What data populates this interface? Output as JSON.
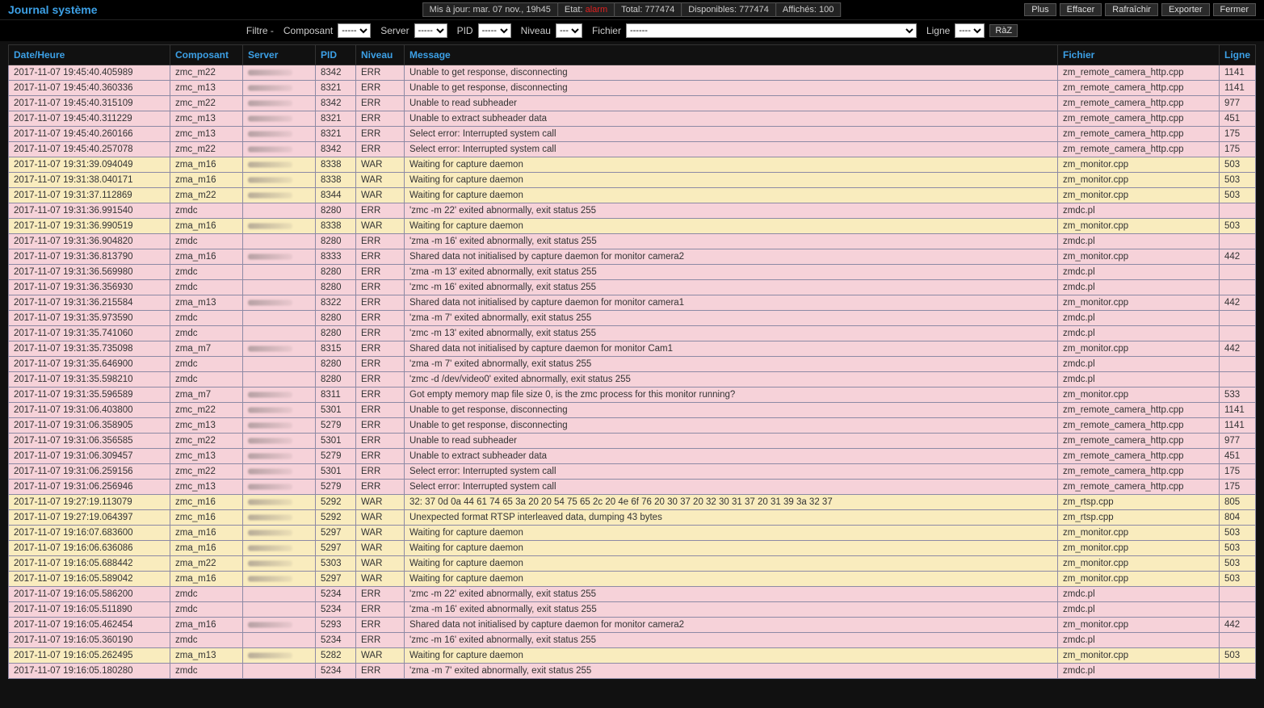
{
  "page": {
    "title": "Journal système"
  },
  "status": {
    "updated_label": "Mis à jour:",
    "updated_value": "mar. 07 nov., 19h45",
    "state_label": "Etat:",
    "state_value": "alarm",
    "total_label": "Total:",
    "total_value": "777474",
    "avail_label": "Disponibles:",
    "avail_value": "777474",
    "shown_label": "Affichés:",
    "shown_value": "100"
  },
  "buttons": {
    "plus": "Plus",
    "effacer": "Effacer",
    "rafraichir": "Rafraîchir",
    "exporter": "Exporter",
    "fermer": "Fermer"
  },
  "filters": {
    "prefix": "Filtre -",
    "composant": "Composant",
    "server": "Server",
    "pid": "PID",
    "niveau": "Niveau",
    "fichier": "Fichier",
    "ligne": "Ligne",
    "raz": "RàZ",
    "dashes5": "-----",
    "dashes3": "---",
    "dashes6": "------",
    "dashes4": "----"
  },
  "columns": {
    "date": "Date/Heure",
    "composant": "Composant",
    "server": "Server",
    "pid": "PID",
    "niveau": "Niveau",
    "message": "Message",
    "fichier": "Fichier",
    "ligne": "Ligne"
  },
  "rows": [
    {
      "date": "2017-11-07 19:45:40.405989",
      "comp": "zmc_m22",
      "server": "x",
      "pid": "8342",
      "lvl": "ERR",
      "msg": "Unable to get response, disconnecting",
      "file": "zm_remote_camera_http.cpp",
      "line": "1141"
    },
    {
      "date": "2017-11-07 19:45:40.360336",
      "comp": "zmc_m13",
      "server": "x",
      "pid": "8321",
      "lvl": "ERR",
      "msg": "Unable to get response, disconnecting",
      "file": "zm_remote_camera_http.cpp",
      "line": "1141"
    },
    {
      "date": "2017-11-07 19:45:40.315109",
      "comp": "zmc_m22",
      "server": "x",
      "pid": "8342",
      "lvl": "ERR",
      "msg": "Unable to read subheader",
      "file": "zm_remote_camera_http.cpp",
      "line": "977"
    },
    {
      "date": "2017-11-07 19:45:40.311229",
      "comp": "zmc_m13",
      "server": "x",
      "pid": "8321",
      "lvl": "ERR",
      "msg": "Unable to extract subheader data",
      "file": "zm_remote_camera_http.cpp",
      "line": "451"
    },
    {
      "date": "2017-11-07 19:45:40.260166",
      "comp": "zmc_m13",
      "server": "x",
      "pid": "8321",
      "lvl": "ERR",
      "msg": "Select error: Interrupted system call",
      "file": "zm_remote_camera_http.cpp",
      "line": "175"
    },
    {
      "date": "2017-11-07 19:45:40.257078",
      "comp": "zmc_m22",
      "server": "x",
      "pid": "8342",
      "lvl": "ERR",
      "msg": "Select error: Interrupted system call",
      "file": "zm_remote_camera_http.cpp",
      "line": "175"
    },
    {
      "date": "2017-11-07 19:31:39.094049",
      "comp": "zma_m16",
      "server": "x",
      "pid": "8338",
      "lvl": "WAR",
      "msg": "Waiting for capture daemon",
      "file": "zm_monitor.cpp",
      "line": "503"
    },
    {
      "date": "2017-11-07 19:31:38.040171",
      "comp": "zma_m16",
      "server": "x",
      "pid": "8338",
      "lvl": "WAR",
      "msg": "Waiting for capture daemon",
      "file": "zm_monitor.cpp",
      "line": "503"
    },
    {
      "date": "2017-11-07 19:31:37.112869",
      "comp": "zma_m22",
      "server": "x",
      "pid": "8344",
      "lvl": "WAR",
      "msg": "Waiting for capture daemon",
      "file": "zm_monitor.cpp",
      "line": "503"
    },
    {
      "date": "2017-11-07 19:31:36.991540",
      "comp": "zmdc",
      "server": "",
      "pid": "8280",
      "lvl": "ERR",
      "msg": "'zmc -m 22' exited abnormally, exit status 255",
      "file": "zmdc.pl",
      "line": ""
    },
    {
      "date": "2017-11-07 19:31:36.990519",
      "comp": "zma_m16",
      "server": "x",
      "pid": "8338",
      "lvl": "WAR",
      "msg": "Waiting for capture daemon",
      "file": "zm_monitor.cpp",
      "line": "503"
    },
    {
      "date": "2017-11-07 19:31:36.904820",
      "comp": "zmdc",
      "server": "",
      "pid": "8280",
      "lvl": "ERR",
      "msg": "'zma -m 16' exited abnormally, exit status 255",
      "file": "zmdc.pl",
      "line": ""
    },
    {
      "date": "2017-11-07 19:31:36.813790",
      "comp": "zma_m16",
      "server": "x",
      "pid": "8333",
      "lvl": "ERR",
      "msg": "Shared data not initialised by capture daemon for monitor camera2",
      "file": "zm_monitor.cpp",
      "line": "442"
    },
    {
      "date": "2017-11-07 19:31:36.569980",
      "comp": "zmdc",
      "server": "",
      "pid": "8280",
      "lvl": "ERR",
      "msg": "'zma -m 13' exited abnormally, exit status 255",
      "file": "zmdc.pl",
      "line": ""
    },
    {
      "date": "2017-11-07 19:31:36.356930",
      "comp": "zmdc",
      "server": "",
      "pid": "8280",
      "lvl": "ERR",
      "msg": "'zmc -m 16' exited abnormally, exit status 255",
      "file": "zmdc.pl",
      "line": ""
    },
    {
      "date": "2017-11-07 19:31:36.215584",
      "comp": "zma_m13",
      "server": "x",
      "pid": "8322",
      "lvl": "ERR",
      "msg": "Shared data not initialised by capture daemon for monitor camera1",
      "file": "zm_monitor.cpp",
      "line": "442"
    },
    {
      "date": "2017-11-07 19:31:35.973590",
      "comp": "zmdc",
      "server": "",
      "pid": "8280",
      "lvl": "ERR",
      "msg": "'zma -m 7' exited abnormally, exit status 255",
      "file": "zmdc.pl",
      "line": ""
    },
    {
      "date": "2017-11-07 19:31:35.741060",
      "comp": "zmdc",
      "server": "",
      "pid": "8280",
      "lvl": "ERR",
      "msg": "'zmc -m 13' exited abnormally, exit status 255",
      "file": "zmdc.pl",
      "line": ""
    },
    {
      "date": "2017-11-07 19:31:35.735098",
      "comp": "zma_m7",
      "server": "x",
      "pid": "8315",
      "lvl": "ERR",
      "msg": "Shared data not initialised by capture daemon for monitor            Cam1",
      "file": "zm_monitor.cpp",
      "line": "442"
    },
    {
      "date": "2017-11-07 19:31:35.646900",
      "comp": "zmdc",
      "server": "",
      "pid": "8280",
      "lvl": "ERR",
      "msg": "'zma -m 7' exited abnormally, exit status 255",
      "file": "zmdc.pl",
      "line": ""
    },
    {
      "date": "2017-11-07 19:31:35.598210",
      "comp": "zmdc",
      "server": "",
      "pid": "8280",
      "lvl": "ERR",
      "msg": "'zmc -d /dev/video0' exited abnormally, exit status 255",
      "file": "zmdc.pl",
      "line": ""
    },
    {
      "date": "2017-11-07 19:31:35.596589",
      "comp": "zma_m7",
      "server": "x",
      "pid": "8311",
      "lvl": "ERR",
      "msg": "Got empty memory map file size 0, is the zmc process for this monitor running?",
      "file": "zm_monitor.cpp",
      "line": "533"
    },
    {
      "date": "2017-11-07 19:31:06.403800",
      "comp": "zmc_m22",
      "server": "x",
      "pid": "5301",
      "lvl": "ERR",
      "msg": "Unable to get response, disconnecting",
      "file": "zm_remote_camera_http.cpp",
      "line": "1141"
    },
    {
      "date": "2017-11-07 19:31:06.358905",
      "comp": "zmc_m13",
      "server": "x",
      "pid": "5279",
      "lvl": "ERR",
      "msg": "Unable to get response, disconnecting",
      "file": "zm_remote_camera_http.cpp",
      "line": "1141"
    },
    {
      "date": "2017-11-07 19:31:06.356585",
      "comp": "zmc_m22",
      "server": "x",
      "pid": "5301",
      "lvl": "ERR",
      "msg": "Unable to read subheader",
      "file": "zm_remote_camera_http.cpp",
      "line": "977"
    },
    {
      "date": "2017-11-07 19:31:06.309457",
      "comp": "zmc_m13",
      "server": "x",
      "pid": "5279",
      "lvl": "ERR",
      "msg": "Unable to extract subheader data",
      "file": "zm_remote_camera_http.cpp",
      "line": "451"
    },
    {
      "date": "2017-11-07 19:31:06.259156",
      "comp": "zmc_m22",
      "server": "x",
      "pid": "5301",
      "lvl": "ERR",
      "msg": "Select error: Interrupted system call",
      "file": "zm_remote_camera_http.cpp",
      "line": "175"
    },
    {
      "date": "2017-11-07 19:31:06.256946",
      "comp": "zmc_m13",
      "server": "x",
      "pid": "5279",
      "lvl": "ERR",
      "msg": "Select error: Interrupted system call",
      "file": "zm_remote_camera_http.cpp",
      "line": "175"
    },
    {
      "date": "2017-11-07 19:27:19.113079",
      "comp": "zmc_m16",
      "server": "x",
      "pid": "5292",
      "lvl": "WAR",
      "msg": "32: 37 0d 0a 44 61 74 65 3a 20 20 54 75 65 2c 20 4e 6f 76 20 30 37 20 32 30 31 37 20 31 39 3a 32 37",
      "file": "zm_rtsp.cpp",
      "line": "805"
    },
    {
      "date": "2017-11-07 19:27:19.064397",
      "comp": "zmc_m16",
      "server": "x",
      "pid": "5292",
      "lvl": "WAR",
      "msg": "Unexpected format RTSP interleaved data, dumping 43 bytes",
      "file": "zm_rtsp.cpp",
      "line": "804"
    },
    {
      "date": "2017-11-07 19:16:07.683600",
      "comp": "zma_m16",
      "server": "x",
      "pid": "5297",
      "lvl": "WAR",
      "msg": "Waiting for capture daemon",
      "file": "zm_monitor.cpp",
      "line": "503"
    },
    {
      "date": "2017-11-07 19:16:06.636086",
      "comp": "zma_m16",
      "server": "x",
      "pid": "5297",
      "lvl": "WAR",
      "msg": "Waiting for capture daemon",
      "file": "zm_monitor.cpp",
      "line": "503"
    },
    {
      "date": "2017-11-07 19:16:05.688442",
      "comp": "zma_m22",
      "server": "x",
      "pid": "5303",
      "lvl": "WAR",
      "msg": "Waiting for capture daemon",
      "file": "zm_monitor.cpp",
      "line": "503"
    },
    {
      "date": "2017-11-07 19:16:05.589042",
      "comp": "zma_m16",
      "server": "x",
      "pid": "5297",
      "lvl": "WAR",
      "msg": "Waiting for capture daemon",
      "file": "zm_monitor.cpp",
      "line": "503"
    },
    {
      "date": "2017-11-07 19:16:05.586200",
      "comp": "zmdc",
      "server": "",
      "pid": "5234",
      "lvl": "ERR",
      "msg": "'zmc -m 22' exited abnormally, exit status 255",
      "file": "zmdc.pl",
      "line": ""
    },
    {
      "date": "2017-11-07 19:16:05.511890",
      "comp": "zmdc",
      "server": "",
      "pid": "5234",
      "lvl": "ERR",
      "msg": "'zma -m 16' exited abnormally, exit status 255",
      "file": "zmdc.pl",
      "line": ""
    },
    {
      "date": "2017-11-07 19:16:05.462454",
      "comp": "zma_m16",
      "server": "x",
      "pid": "5293",
      "lvl": "ERR",
      "msg": "Shared data not initialised by capture daemon for monitor camera2",
      "file": "zm_monitor.cpp",
      "line": "442"
    },
    {
      "date": "2017-11-07 19:16:05.360190",
      "comp": "zmdc",
      "server": "",
      "pid": "5234",
      "lvl": "ERR",
      "msg": "'zmc -m 16' exited abnormally, exit status 255",
      "file": "zmdc.pl",
      "line": ""
    },
    {
      "date": "2017-11-07 19:16:05.262495",
      "comp": "zma_m13",
      "server": "x",
      "pid": "5282",
      "lvl": "WAR",
      "msg": "Waiting for capture daemon",
      "file": "zm_monitor.cpp",
      "line": "503"
    },
    {
      "date": "2017-11-07 19:16:05.180280",
      "comp": "zmdc",
      "server": "",
      "pid": "5234",
      "lvl": "ERR",
      "msg": "'zma -m 7' exited abnormally, exit status 255",
      "file": "zmdc.pl",
      "line": ""
    }
  ]
}
